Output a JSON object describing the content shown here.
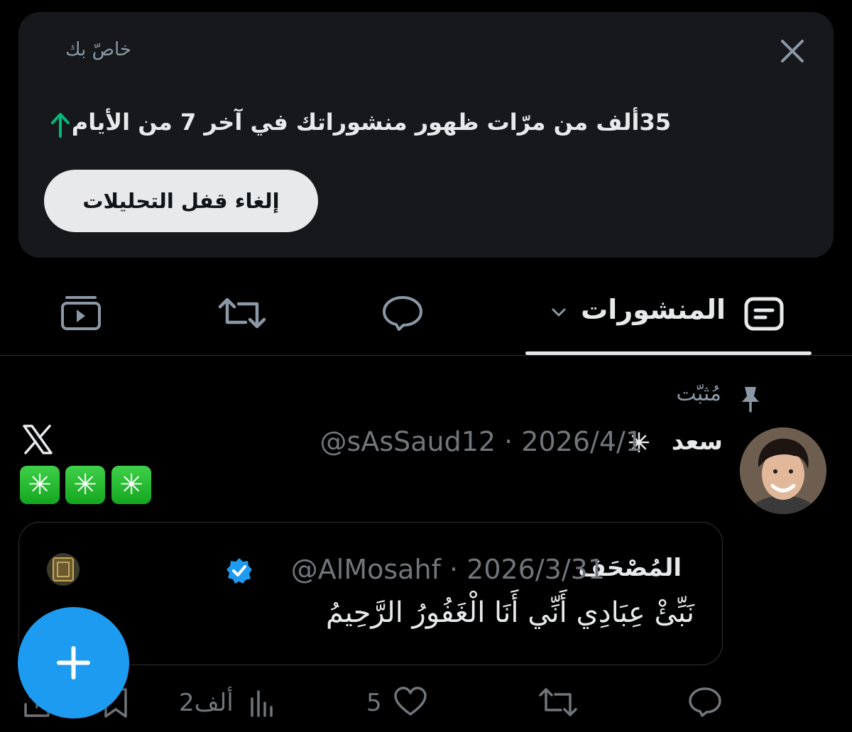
{
  "analytics_card": {
    "label": "خاصّ بك",
    "headline": "35ألف من مرّات ظهور منشوراتك في آخر 7 من الأيام",
    "unlock_button": "إلغاء قفل التحليلات",
    "trend_icon": "up-arrow-icon",
    "trend_color": "#00ba7c"
  },
  "tabs": {
    "posts_label": "المنشورات",
    "icons": [
      "posts-icon",
      "replies-icon",
      "reposts-icon",
      "media-icon"
    ]
  },
  "post": {
    "pinned_label": "مُثبّت",
    "author_name": "سعد",
    "author_meta": "@sAsSaud12 · 2026/4/1",
    "body_emoji": [
      "✳",
      "✳",
      "✳"
    ],
    "quote": {
      "name": "المُصْحَف",
      "meta": "@AlMosahf · 2026/3/31",
      "text": "نَبِّئْ عِبَادِي أَنِّي أَنَا الْغَفُورُ الرَّحِيمُ"
    },
    "actions": {
      "likes": "5",
      "views": "2ألف"
    }
  },
  "colors": {
    "background": "#000000",
    "card": "#16181c",
    "accent": "#1d9bf0",
    "verified": "#1d9bf0"
  }
}
